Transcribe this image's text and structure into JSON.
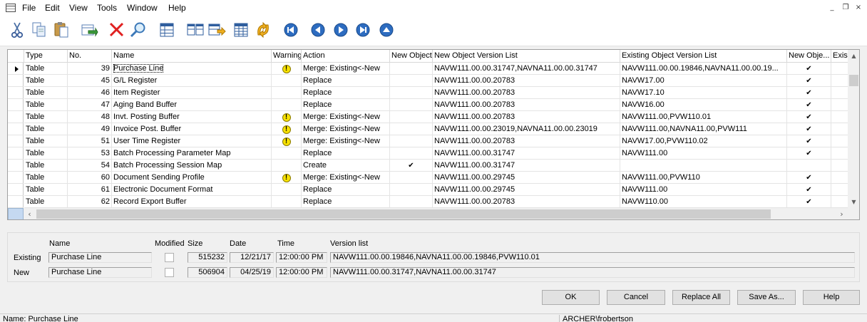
{
  "menu": [
    "File",
    "Edit",
    "View",
    "Tools",
    "Window",
    "Help"
  ],
  "window_controls": [
    "_",
    "❐",
    "×"
  ],
  "toolbar": {
    "icons": [
      "cut-icon",
      "copy-icon",
      "paste-icon",
      "transfer-icon",
      "delete-icon",
      "find-icon",
      "table-icon",
      "compare-icon",
      "export-icon",
      "table-grid-icon",
      "refresh-icon",
      "first-icon",
      "previous-icon",
      "next-icon",
      "last-icon",
      "up-icon"
    ]
  },
  "columns": [
    "Type",
    "No.",
    "Name",
    "Warning",
    "Action",
    "New Object",
    "New Object Version List",
    "Existing Object Version List",
    "New Obje...",
    "Exist"
  ],
  "rows": [
    {
      "type": "Table",
      "no": "39",
      "name": "Purchase Line",
      "warning": true,
      "action": "Merge: Existing<-New",
      "new_object": false,
      "new_version": "NAVW111.00.00.31747,NAVNA11.00.00.31747",
      "existing_version": "NAVW111.00.00.19846,NAVNA11.00.00.19...",
      "new_obj_flag": true
    },
    {
      "type": "Table",
      "no": "45",
      "name": "G/L Register",
      "warning": false,
      "action": "Replace",
      "new_object": false,
      "new_version": "NAVW111.00.00.20783",
      "existing_version": "NAVW17.00",
      "new_obj_flag": true
    },
    {
      "type": "Table",
      "no": "46",
      "name": "Item Register",
      "warning": false,
      "action": "Replace",
      "new_object": false,
      "new_version": "NAVW111.00.00.20783",
      "existing_version": "NAVW17.10",
      "new_obj_flag": true
    },
    {
      "type": "Table",
      "no": "47",
      "name": "Aging Band Buffer",
      "warning": false,
      "action": "Replace",
      "new_object": false,
      "new_version": "NAVW111.00.00.20783",
      "existing_version": "NAVW16.00",
      "new_obj_flag": true
    },
    {
      "type": "Table",
      "no": "48",
      "name": "Invt. Posting Buffer",
      "warning": true,
      "action": "Merge: Existing<-New",
      "new_object": false,
      "new_version": "NAVW111.00.00.20783",
      "existing_version": "NAVW111.00,PVW110.01",
      "new_obj_flag": true
    },
    {
      "type": "Table",
      "no": "49",
      "name": "Invoice Post. Buffer",
      "warning": true,
      "action": "Merge: Existing<-New",
      "new_object": false,
      "new_version": "NAVW111.00.00.23019,NAVNA11.00.00.23019",
      "existing_version": "NAVW111.00,NAVNA11.00,PVW111",
      "new_obj_flag": true
    },
    {
      "type": "Table",
      "no": "51",
      "name": "User Time Register",
      "warning": true,
      "action": "Merge: Existing<-New",
      "new_object": false,
      "new_version": "NAVW111.00.00.20783",
      "existing_version": "NAVW17.00,PVW110.02",
      "new_obj_flag": true
    },
    {
      "type": "Table",
      "no": "53",
      "name": "Batch Processing Parameter Map",
      "warning": false,
      "action": "Replace",
      "new_object": false,
      "new_version": "NAVW111.00.00.31747",
      "existing_version": "NAVW111.00",
      "new_obj_flag": true
    },
    {
      "type": "Table",
      "no": "54",
      "name": "Batch Processing Session Map",
      "warning": false,
      "action": "Create",
      "new_object": true,
      "new_version": "NAVW111.00.00.31747",
      "existing_version": "",
      "new_obj_flag": false
    },
    {
      "type": "Table",
      "no": "60",
      "name": "Document Sending Profile",
      "warning": true,
      "action": "Merge: Existing<-New",
      "new_object": false,
      "new_version": "NAVW111.00.00.29745",
      "existing_version": "NAVW111.00,PVW110",
      "new_obj_flag": true
    },
    {
      "type": "Table",
      "no": "61",
      "name": "Electronic Document Format",
      "warning": false,
      "action": "Replace",
      "new_object": false,
      "new_version": "NAVW111.00.00.29745",
      "existing_version": "NAVW111.00",
      "new_obj_flag": true
    },
    {
      "type": "Table",
      "no": "62",
      "name": "Record Export Buffer",
      "warning": false,
      "action": "Replace",
      "new_object": false,
      "new_version": "NAVW111.00.00.20783",
      "existing_version": "NAVW110.00",
      "new_obj_flag": true
    }
  ],
  "detail": {
    "headers": {
      "name": "Name",
      "modified": "Modified",
      "size": "Size",
      "date": "Date",
      "time": "Time",
      "version_list": "Version list"
    },
    "existing": {
      "label": "Existing",
      "name": "Purchase Line",
      "modified": false,
      "size": "515232",
      "date": "12/21/17",
      "time": "12:00:00 PM",
      "version_list": "NAVW111.00.00.19846,NAVNA11.00.00.19846,PVW110.01"
    },
    "new": {
      "label": "New",
      "name": "Purchase Line",
      "modified": false,
      "size": "506904",
      "date": "04/25/19",
      "time": "12:00:00 PM",
      "version_list": "NAVW111.00.00.31747,NAVNA11.00.00.31747"
    }
  },
  "buttons": {
    "ok": "OK",
    "cancel": "Cancel",
    "replace_all": "Replace All",
    "save_as": "Save As...",
    "help": "Help"
  },
  "status": {
    "name": "Name: Purchase Line",
    "user": "ARCHER\\frobertson"
  }
}
